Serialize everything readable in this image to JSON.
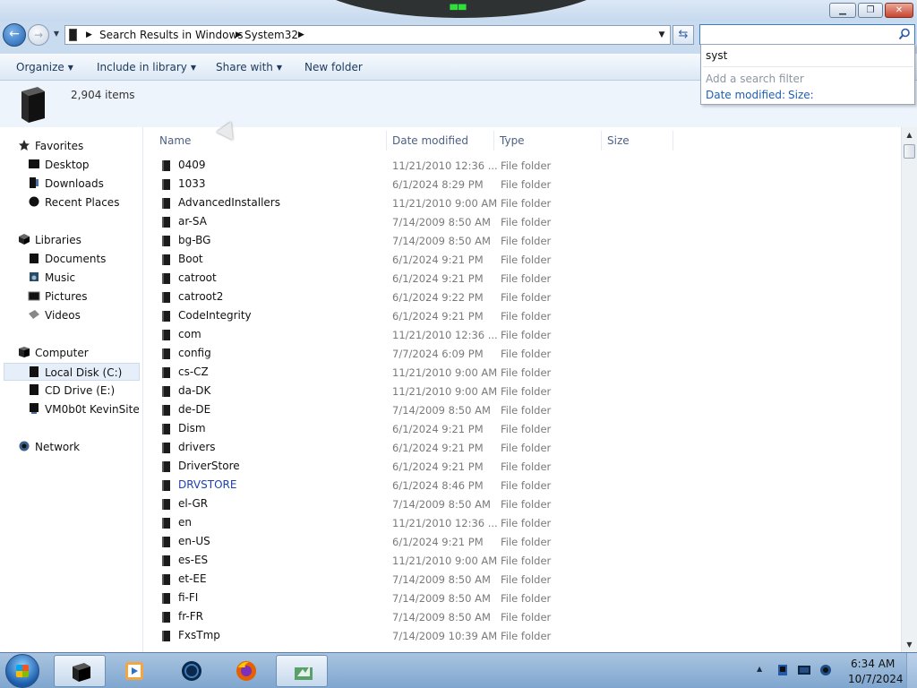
{
  "window": {
    "controls": {
      "minimize": "▁",
      "maximize": "❐",
      "close": "✕"
    }
  },
  "nav": {
    "back_icon": "←",
    "forward_icon": "→",
    "breadcrumbs": [
      "Search Results in Windows",
      "System32"
    ],
    "search_value": ""
  },
  "search_popup": {
    "history_entry": "syst",
    "filter_hint": "Add a search filter",
    "filter_date": "Date modified:",
    "filter_size": "Size:"
  },
  "toolbar": {
    "organize": "Organize",
    "include_in_library": "Include in library",
    "share_with": "Share with",
    "new_folder": "New folder"
  },
  "details": {
    "item_count": "2,904 items"
  },
  "sidebar": {
    "favorites": {
      "label": "Favorites",
      "items": [
        "Desktop",
        "Downloads",
        "Recent Places"
      ]
    },
    "libraries": {
      "label": "Libraries",
      "items": [
        "Documents",
        "Music",
        "Pictures",
        "Videos"
      ]
    },
    "computer": {
      "label": "Computer",
      "items": [
        "Local Disk (C:)",
        "CD Drive (E:)",
        "VM0b0t KevinSite"
      ]
    },
    "network": {
      "label": "Network"
    }
  },
  "columns": [
    "Name",
    "Date modified",
    "Type",
    "Size"
  ],
  "files": [
    {
      "name": "0409",
      "date": "11/21/2010 12:36 ...",
      "type": "File folder"
    },
    {
      "name": "1033",
      "date": "6/1/2024 8:29 PM",
      "type": "File folder"
    },
    {
      "name": "AdvancedInstallers",
      "date": "11/21/2010 9:00 AM",
      "type": "File folder"
    },
    {
      "name": "ar-SA",
      "date": "7/14/2009 8:50 AM",
      "type": "File folder"
    },
    {
      "name": "bg-BG",
      "date": "7/14/2009 8:50 AM",
      "type": "File folder"
    },
    {
      "name": "Boot",
      "date": "6/1/2024 9:21 PM",
      "type": "File folder"
    },
    {
      "name": "catroot",
      "date": "6/1/2024 9:21 PM",
      "type": "File folder"
    },
    {
      "name": "catroot2",
      "date": "6/1/2024 9:22 PM",
      "type": "File folder"
    },
    {
      "name": "CodeIntegrity",
      "date": "6/1/2024 9:21 PM",
      "type": "File folder"
    },
    {
      "name": "com",
      "date": "11/21/2010 12:36 ...",
      "type": "File folder"
    },
    {
      "name": "config",
      "date": "7/7/2024 6:09 PM",
      "type": "File folder"
    },
    {
      "name": "cs-CZ",
      "date": "11/21/2010 9:00 AM",
      "type": "File folder"
    },
    {
      "name": "da-DK",
      "date": "11/21/2010 9:00 AM",
      "type": "File folder"
    },
    {
      "name": "de-DE",
      "date": "7/14/2009 8:50 AM",
      "type": "File folder"
    },
    {
      "name": "Dism",
      "date": "6/1/2024 9:21 PM",
      "type": "File folder"
    },
    {
      "name": "drivers",
      "date": "6/1/2024 9:21 PM",
      "type": "File folder"
    },
    {
      "name": "DriverStore",
      "date": "6/1/2024 9:21 PM",
      "type": "File folder"
    },
    {
      "name": "DRVSTORE",
      "date": "6/1/2024 8:46 PM",
      "type": "File folder",
      "highlight": true
    },
    {
      "name": "el-GR",
      "date": "7/14/2009 8:50 AM",
      "type": "File folder"
    },
    {
      "name": "en",
      "date": "11/21/2010 12:36 ...",
      "type": "File folder"
    },
    {
      "name": "en-US",
      "date": "6/1/2024 9:21 PM",
      "type": "File folder"
    },
    {
      "name": "es-ES",
      "date": "11/21/2010 9:00 AM",
      "type": "File folder"
    },
    {
      "name": "et-EE",
      "date": "7/14/2009 8:50 AM",
      "type": "File folder"
    },
    {
      "name": "fi-FI",
      "date": "7/14/2009 8:50 AM",
      "type": "File folder"
    },
    {
      "name": "fr-FR",
      "date": "7/14/2009 8:50 AM",
      "type": "File folder"
    },
    {
      "name": "FxsTmp",
      "date": "7/14/2009 10:39 AM",
      "type": "File folder"
    }
  ],
  "taskbar": {
    "apps": [
      "explorer-icon",
      "media-player-icon",
      "globe-icon",
      "firefox-icon",
      "app-icon"
    ],
    "tray_expand": "▲",
    "time": "6:34 AM",
    "date": "10/7/2024"
  },
  "colors": {
    "link": "#1e3fb0",
    "accent": "#3d7bc6"
  }
}
